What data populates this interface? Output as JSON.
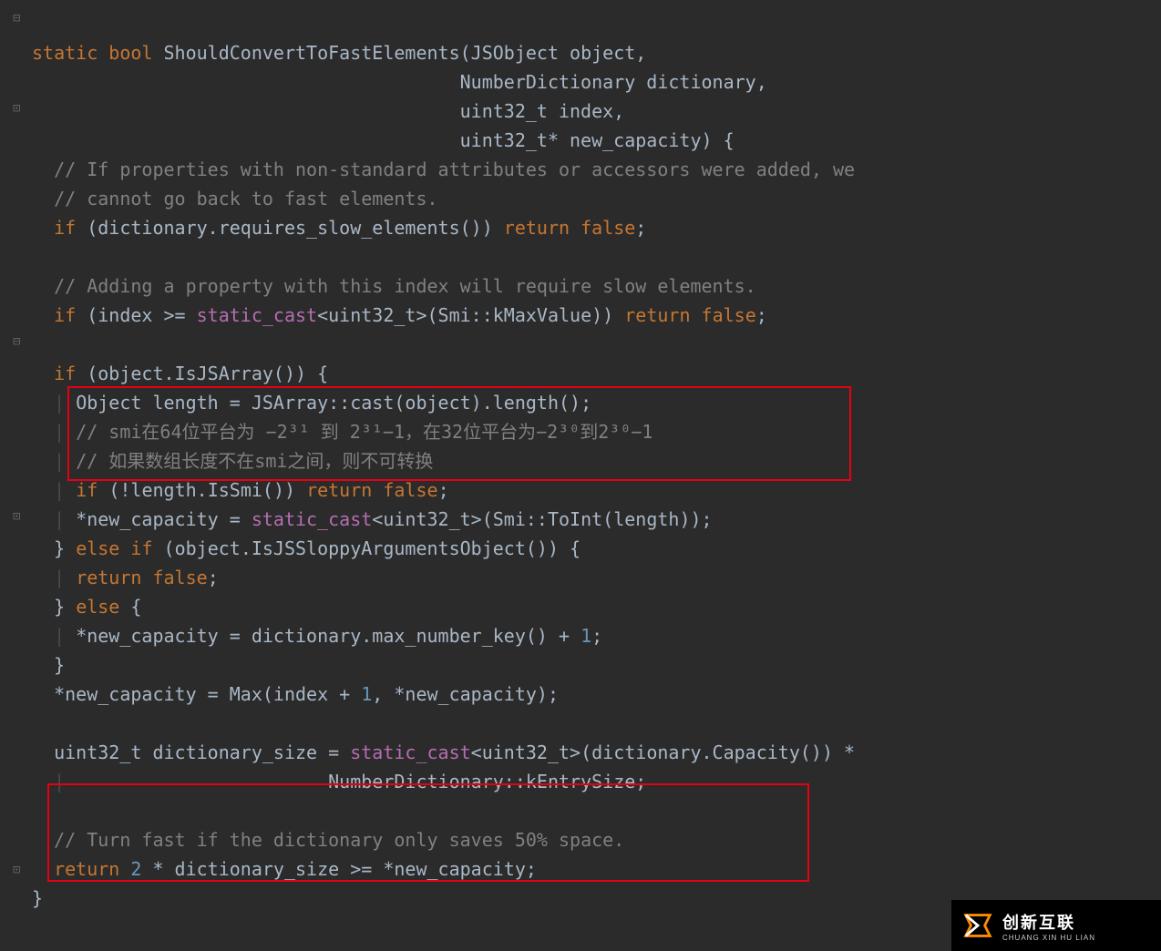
{
  "code": {
    "fn_decl_1": "static",
    "fn_decl_2": "bool",
    "fn_name": "ShouldConvertToFastElements",
    "params": {
      "p1": "JSObject object,",
      "p2": "NumberDictionary dictionary,",
      "p3": "uint32_t index,",
      "p4": "uint32_t* new_capacity) {"
    },
    "l5": "// If properties with non-standard attributes or accessors were added, we",
    "l6": "// cannot go back to fast elements.",
    "l7a": "if",
    "l7b": " (dictionary.requires_slow_elements()) ",
    "l7c": "return",
    "l7d": " false",
    "l7e": ";",
    "l9": "// Adding a property with this index will require slow elements.",
    "l10a": "if",
    "l10b": " (index >= ",
    "l10c": "static_cast",
    "l10d": "<uint32_t>(Smi::kMaxValue)) ",
    "l10e": "return",
    "l10f": " false",
    "l10g": ";",
    "l12a": "if",
    "l12b": " (object.IsJSArray()) {",
    "l13": "Object length = JSArray::cast(object).length();",
    "l14": "// smi在64位平台为 −2³¹ 到 2³¹−1，在32位平台为−2³⁰到2³⁰−1",
    "l15": "// 如果数组长度不在smi之间，则不可转换",
    "l16a": "if",
    "l16b": " (!length.IsSmi()) ",
    "l16c": "return",
    "l16d": " false",
    "l16e": ";",
    "l17a": "*new_capacity = ",
    "l17b": "static_cast",
    "l17c": "<uint32_t>(Smi::ToInt(length));",
    "l18a": "} ",
    "l18b": "else",
    "l18c": " if",
    "l18d": " (object.IsJSSloppyArgumentsObject()) {",
    "l19a": "return",
    "l19b": " false",
    "l19c": ";",
    "l20a": "} ",
    "l20b": "else",
    "l20c": " {",
    "l21a": "*new_capacity = dictionary.max_number_key() + ",
    "l21b": "1",
    "l21c": ";",
    "l22": "}",
    "l23a": "*new_capacity = Max(index + ",
    "l23b": "1",
    "l23c": ", *new_capacity);",
    "l25a": "uint32_t dictionary_size = ",
    "l25b": "static_cast",
    "l25c": "<uint32_t>(dictionary.Capacity()) *",
    "l26": "NumberDictionary::kEntrySize;",
    "l28": "// Turn fast if the dictionary only saves 50% space.",
    "l29a": "return",
    "l29b": " 2",
    "l29c": " * dictionary_size >= *new_capacity;",
    "l30": "}"
  },
  "fold_markers": [
    "⊟",
    "⊡",
    "⊟",
    "⊡",
    "⊡"
  ],
  "watermark": {
    "cn": "创新互联",
    "en": "CHUANG XIN HU LIAN"
  }
}
